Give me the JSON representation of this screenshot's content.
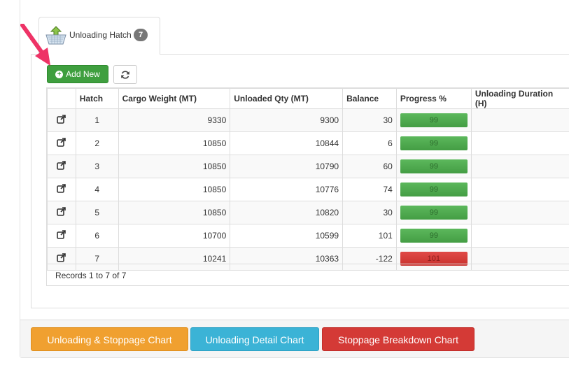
{
  "tab": {
    "label": "Unloading Hatch",
    "badge": "7",
    "icon": "unloading-basket-icon"
  },
  "toolbar": {
    "add_label": "Add New",
    "add_icon": "plus-circle-icon",
    "refresh_icon": "refresh-icon"
  },
  "table": {
    "headers": [
      "",
      "Hatch",
      "Cargo Weight (MT)",
      "Unloaded Qty (MT)",
      "Balance",
      "Progress %",
      "Unloading Duration (H)"
    ],
    "rows": [
      {
        "hatch": "1",
        "cargo_weight": "9330",
        "unloaded_qty": "9300",
        "balance": "30",
        "progress": "99",
        "status": "green"
      },
      {
        "hatch": "2",
        "cargo_weight": "10850",
        "unloaded_qty": "10844",
        "balance": "6",
        "progress": "99",
        "status": "green"
      },
      {
        "hatch": "3",
        "cargo_weight": "10850",
        "unloaded_qty": "10790",
        "balance": "60",
        "progress": "99",
        "status": "green"
      },
      {
        "hatch": "4",
        "cargo_weight": "10850",
        "unloaded_qty": "10776",
        "balance": "74",
        "progress": "99",
        "status": "green"
      },
      {
        "hatch": "5",
        "cargo_weight": "10850",
        "unloaded_qty": "10820",
        "balance": "30",
        "progress": "99",
        "status": "green"
      },
      {
        "hatch": "6",
        "cargo_weight": "10700",
        "unloaded_qty": "10599",
        "balance": "101",
        "progress": "99",
        "status": "green"
      },
      {
        "hatch": "7",
        "cargo_weight": "10241",
        "unloaded_qty": "10363",
        "balance": "-122",
        "progress": "101",
        "status": "red"
      }
    ],
    "footer": "Records 1 to 7 of 7"
  },
  "bottom_buttons": {
    "stoppage_chart": "Unloading & Stoppage Chart",
    "detail_chart": "Unloading Detail Chart",
    "breakdown_chart": "Stoppage Breakdown Chart"
  },
  "colors": {
    "add_green": "#3f9f3f",
    "progress_green": "#5cb85c",
    "progress_red": "#d9534f",
    "orange": "#f0a030",
    "blue": "#3bb3d6",
    "red": "#d43a36",
    "arrow": "#ee3366"
  }
}
